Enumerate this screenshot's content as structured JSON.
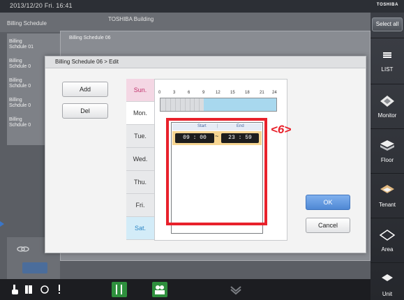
{
  "status_bar": {
    "datetime": "2013/12/20 Fri. 16:41",
    "logo": "TOSHIBA"
  },
  "background": {
    "header_tab": "Billing Schedule",
    "building": "TOSHIBA Building",
    "list_items": [
      "Billing Schdule 01",
      "Billing Schdule 0",
      "Billing Schdule 0",
      "Billing Schdule 0",
      "Billing Schdule 0"
    ],
    "panel_title": "Billing Schedule 06"
  },
  "right_panel": {
    "select_all": "Select all",
    "nav": [
      {
        "label": "LIST",
        "icon": "list-icon"
      },
      {
        "label": "Monitor",
        "icon": "monitor-icon"
      },
      {
        "label": "Floor",
        "icon": "floor-icon"
      },
      {
        "label": "Tenant",
        "icon": "tenant-icon"
      },
      {
        "label": "Area",
        "icon": "area-icon"
      },
      {
        "label": "Unit",
        "icon": "unit-icon"
      }
    ]
  },
  "dialog": {
    "title": "Billing Schedule 06 > Edit",
    "add_label": "Add",
    "del_label": "Del",
    "ok_label": "OK",
    "cancel_label": "Cancel",
    "days": [
      "Sun.",
      "Mon.",
      "Tue.",
      "Wed.",
      "Thu.",
      "Fri.",
      "Sat."
    ],
    "selected_day": "Mon.",
    "timeline_labels": [
      "0",
      "3",
      "6",
      "9",
      "12",
      "15",
      "18",
      "21",
      "24"
    ],
    "active_range_hours": [
      9,
      24
    ],
    "range_header": {
      "start": "Start",
      "end": "End"
    },
    "range": {
      "start_hour": "09",
      "start_min": "00",
      "separator": "~",
      "end_hour": "23",
      "end_min": "59"
    }
  },
  "annotation": {
    "label": "<6>",
    "color": "#e8212b"
  },
  "colors": {
    "accent_blue": "#4f88d4",
    "sunday": "#f4d7e4",
    "saturday": "#d3ecf8",
    "active_time": "#a8d8ee",
    "range_row": "#f6d591"
  }
}
